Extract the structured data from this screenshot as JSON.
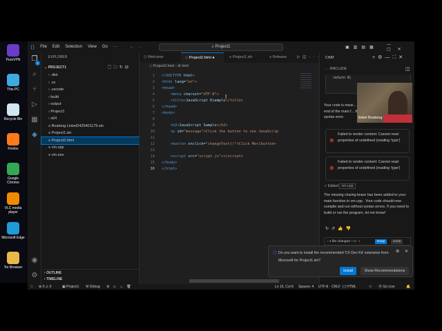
{
  "desktop": {
    "icons": [
      {
        "label": "PureVPN",
        "color": "#6a3cc8"
      },
      {
        "label": "This PC",
        "color": "#3fa9e0"
      },
      {
        "label": "Recycle Bin",
        "color": "#d0e6f0"
      },
      {
        "label": "Firefox",
        "color": "#ff7a1a"
      },
      {
        "label": "Google Chrome",
        "color": "#34a853"
      },
      {
        "label": "VLC media player",
        "color": "#f08a00"
      },
      {
        "label": "Microsoft Edge",
        "color": "#1f9bd8"
      },
      {
        "label": "Tor Browser",
        "color": "#e8b84a"
      }
    ]
  },
  "menu": [
    "File",
    "Edit",
    "Selection",
    "View",
    "Go",
    "···"
  ],
  "search": "Project1",
  "explorer": {
    "title": "EXPLORER",
    "project": "PROJECT1",
    "items": [
      {
        "label": ".dist",
        "type": "folder"
      },
      {
        "label": ".vs",
        "type": "folder"
      },
      {
        "label": ".vscode",
        "type": "folder"
      },
      {
        "label": "build",
        "type": "folder"
      },
      {
        "label": "output",
        "type": "folder"
      },
      {
        "label": "Project1",
        "type": "folder"
      },
      {
        "label": "x64",
        "type": "folder"
      },
      {
        "label": "Boateng Linkel2425401179.sln",
        "type": "file"
      },
      {
        "label": "Project1.sln",
        "type": "file"
      },
      {
        "label": "Project2.html",
        "type": "file",
        "selected": true
      },
      {
        "label": "vm.cpp",
        "type": "file"
      },
      {
        "label": "vm.exe",
        "type": "file"
      }
    ],
    "outline": "OUTLINE",
    "timeline": "TIMELINE",
    "badge": "1"
  },
  "tabs": [
    {
      "label": "Welcome"
    },
    {
      "label": "Project2.html",
      "active": true,
      "dirty": "●"
    },
    {
      "label": "Project1.sln"
    }
  ],
  "run_config": "Release",
  "breadcrumb": [
    "Project2.html",
    "html"
  ],
  "code": [
    [
      "<!DOCTYPE ",
      "html",
      ">"
    ],
    [
      "<html ",
      "lang=",
      "\"en\">"
    ],
    [
      "<head>",
      "",
      ""
    ],
    [
      "    <meta ",
      "charset=",
      "\"UTF-8\">"
    ],
    [
      "    <title>",
      "JavaScript Example",
      "</title>"
    ],
    [
      "</head>",
      "",
      ""
    ],
    [
      "<body>",
      "",
      ""
    ],
    [
      "",
      "",
      ""
    ],
    [
      "    <h2>",
      "JavaScript Sample",
      "</h2>"
    ],
    [
      "    <p ",
      "id=",
      "\"message\">Click the button to see JavaScrip"
    ],
    [
      "",
      "",
      ""
    ],
    [
      "    <button ",
      "onclick=",
      "\"changeText()\">Click Me</button>"
    ],
    [
      "",
      "",
      ""
    ],
    [
      "    <script ",
      "src=",
      "\"script.js\"></script>"
    ],
    [
      "</body>",
      "",
      ""
    ],
    [
      "</html>",
      "",
      ""
    ]
  ],
  "chat": {
    "title": "CHAT",
    "context": "#INCLUDE",
    "code_snippet": "return 0;",
    "intro": "Your code is missi... end of the main f... the syntax error.",
    "errors": [
      "Failed to render content: Cannot read properties of undefined (reading 'type')",
      "Failed to render content: Cannot read properties of undefined (reading 'type')"
    ],
    "edited": "Edited",
    "edited_file": "vm.cpp",
    "response": "The missing closing brace has been added to your main function in vm.cpp . Your code should now compile and run without syntax errors. If you need to build or run the program, let me know!",
    "files_changed": "1 file changed",
    "added": "+22",
    "removed": "-1",
    "keep": "Keep",
    "undo": "Undo"
  },
  "webcam": {
    "name": "linkel Boateng"
  },
  "notification": {
    "message": "Do you want to install the recommended 'C# Dev Kit' extension from Microsoft for Project1.sln?",
    "install": "Install",
    "show": "Show Recommendations"
  },
  "status": {
    "errors": "0",
    "warnings": "0",
    "project": "Project1",
    "debug": "Debug",
    "position": "Ln 16, Col 8",
    "spaces": "Spaces: 4",
    "encoding": "UTF-8",
    "eol": "CRLF",
    "language": "{ } HTML",
    "golive": "Go Live"
  }
}
